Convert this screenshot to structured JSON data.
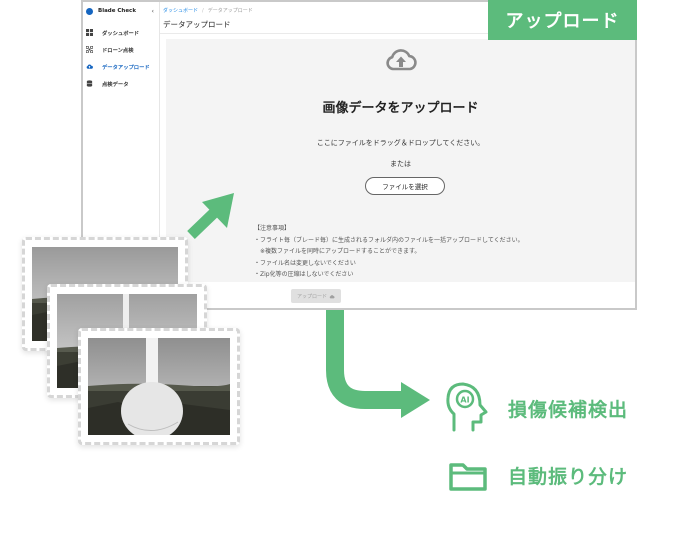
{
  "banner": {
    "label": "アップロード"
  },
  "app": {
    "name": "Blade Check",
    "collapse_glyph": "‹"
  },
  "sidebar": {
    "items": [
      {
        "label": "ダッシュボード",
        "icon": "dashboard-icon",
        "active": false
      },
      {
        "label": "ドローン点検",
        "icon": "drone-icon",
        "active": false
      },
      {
        "label": "データアップロード",
        "icon": "cloud-upload-icon",
        "active": true
      },
      {
        "label": "点検データ",
        "icon": "database-icon",
        "active": false
      }
    ]
  },
  "breadcrumb": {
    "parent": "ダッシュボード",
    "separator": "/",
    "current": "データアップロード"
  },
  "page": {
    "title": "データアップロード"
  },
  "dropzone": {
    "icon": "cloud-upload-icon",
    "title": "画像データをアップロード",
    "instruction": "ここにファイルをドラッグ＆ドロップしてください。",
    "or": "または",
    "select_button": "ファイルを選択"
  },
  "notes": {
    "heading": "【注意事項】",
    "lines": [
      "・フライト毎（ブレード毎）に生成されるフォルダ内のファイルを一括アップロードしてください。",
      "　※複数ファイルを同時にアップロードすることができます。",
      "・ファイル名は変更しないでください",
      "・Zip化等の圧縮はしないでください"
    ]
  },
  "upload_button": {
    "label": "アップロード",
    "icon": "cloud-upload-icon"
  },
  "features": [
    {
      "label": "損傷候補検出",
      "icon": "ai-head-icon"
    },
    {
      "label": "自動振り分け",
      "icon": "folder-icon"
    }
  ],
  "colors": {
    "accent_green": "#5cbb7c",
    "primary_blue": "#1565c0",
    "link_blue": "#1e88e5"
  }
}
